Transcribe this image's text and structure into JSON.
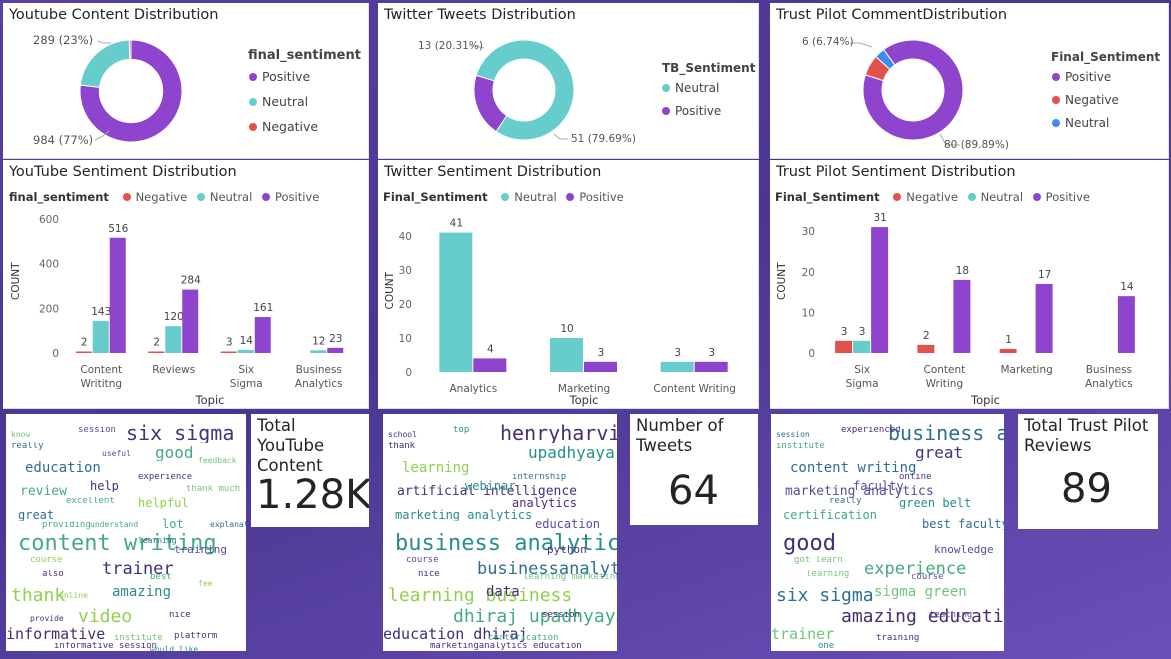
{
  "colors": {
    "positive": "#8e44cc",
    "neutral": "#66cccc",
    "negative": "#e0534d",
    "trust_neutral": "#3b8ef0"
  },
  "donuts": {
    "youtube": {
      "title": "Youtube Content Distribution",
      "legend_title": "final_sentiment",
      "legend": [
        "Positive",
        "Neutral",
        "Negative"
      ],
      "label_top": "289 (23%)",
      "label_bottom": "984 (77%)"
    },
    "twitter": {
      "title": "Twitter Tweets Distribution",
      "legend_title": "TB_Sentiment",
      "legend": [
        "Neutral",
        "Positive"
      ],
      "label_top": "13 (20.31%)",
      "label_bottom": "51 (79.69%)"
    },
    "trust": {
      "title": "Trust Pilot CommentDistribution",
      "legend_title": "Final_Sentiment",
      "legend": [
        "Positive",
        "Negative",
        "Neutral"
      ],
      "label_top": "6 (6.74%)",
      "label_bottom": "80 (89.89%)"
    }
  },
  "bars": {
    "youtube": {
      "title": "YouTube Sentiment Distribution",
      "legend_title": "final_sentiment",
      "legend": [
        "Negative",
        "Neutral",
        "Positive"
      ],
      "ylabel": "COUNT",
      "xlabel": "Topic"
    },
    "twitter": {
      "title": "Twitter Sentiment Distribution",
      "legend_title": "Final_Sentiment",
      "legend": [
        "Neutral",
        "Positive"
      ],
      "ylabel": "COUNT",
      "xlabel": "Topic"
    },
    "trust": {
      "title": "Trust Pilot Sentiment Distribution",
      "legend_title": "Final_Sentiment",
      "legend": [
        "Negative",
        "Neutral",
        "Positive"
      ],
      "ylabel": "COUNT",
      "xlabel": "Topic"
    }
  },
  "cards": {
    "youtube": {
      "label": "Total YouTube Content",
      "value": "1.28K"
    },
    "twitter": {
      "label": "Number of Tweets",
      "value": "64"
    },
    "trust": {
      "label": "Total Trust Pilot Reviews",
      "value": "89"
    }
  },
  "wordclouds": {
    "youtube": [
      "content writing",
      "thank",
      "six sigma",
      "education",
      "review",
      "helpful",
      "trainer",
      "informative",
      "video",
      "good",
      "great",
      "amazing",
      "training",
      "help",
      "lot",
      "really",
      "session",
      "experience",
      "course",
      "best",
      "also",
      "nice",
      "know",
      "institute",
      "informative session",
      "excellent",
      "thank much",
      "platform",
      "providing",
      "fee",
      "useful",
      "learning",
      "provide",
      "feedback",
      "understand",
      "explanation",
      "online",
      "would like"
    ],
    "twitter": [
      "business analytics",
      "learning business",
      "henryharvin",
      "learning",
      "artificial intelligence",
      "analytics",
      "businessanalytics",
      "education dhiraj",
      "dhiraj upadhyaya",
      "upadhyaya sep",
      "marketing analytics",
      "data",
      "python",
      "webinar",
      "education",
      "thank",
      "top",
      "internship",
      "course",
      "learning marketing",
      "nice",
      "session",
      "school",
      "certification",
      "marketinganalytics education"
    ],
    "trust": [
      "good",
      "six sigma",
      "business analytics",
      "content writing",
      "marketing analytics",
      "green belt",
      "experience",
      "trainer",
      "amazing education",
      "great",
      "certification",
      "sigma green",
      "knowledge",
      "faculty",
      "best faculty",
      "institute",
      "experienced",
      "online",
      "got learn",
      "course",
      "learning",
      "teaching",
      "session",
      "training",
      "one",
      "really"
    ]
  },
  "chart_data": [
    {
      "type": "pie",
      "title": "Youtube Content Distribution",
      "legend_title": "final_sentiment",
      "categories": [
        "Positive",
        "Neutral",
        "Negative"
      ],
      "values": [
        984,
        289,
        7
      ],
      "labels": [
        "984 (77%)",
        "289 (23%)",
        ""
      ]
    },
    {
      "type": "pie",
      "title": "Twitter Tweets Distribution",
      "legend_title": "TB_Sentiment",
      "categories": [
        "Neutral",
        "Positive"
      ],
      "values": [
        51,
        13
      ],
      "labels": [
        "51 (79.69%)",
        "13 (20.31%)"
      ]
    },
    {
      "type": "pie",
      "title": "Trust Pilot CommentDistribution",
      "legend_title": "Final_Sentiment",
      "categories": [
        "Positive",
        "Negative",
        "Neutral"
      ],
      "values": [
        80,
        6,
        3
      ],
      "labels": [
        "80 (89.89%)",
        "6 (6.74%)",
        ""
      ]
    },
    {
      "type": "bar",
      "title": "YouTube Sentiment Distribution",
      "categories": [
        "Content Writitng",
        "Reviews",
        "Six Sigma",
        "Business Analytics"
      ],
      "series": [
        {
          "name": "Negative",
          "values": [
            2,
            2,
            3,
            null
          ]
        },
        {
          "name": "Neutral",
          "values": [
            143,
            120,
            14,
            12
          ]
        },
        {
          "name": "Positive",
          "values": [
            516,
            284,
            161,
            23
          ]
        }
      ],
      "xlabel": "Topic",
      "ylabel": "COUNT",
      "ylim": [
        0,
        600
      ],
      "yticks": [
        0,
        200,
        400,
        600
      ]
    },
    {
      "type": "bar",
      "title": "Twitter Sentiment Distribution",
      "categories": [
        "Analytics",
        "Marketing",
        "Content Writing"
      ],
      "series": [
        {
          "name": "Neutral",
          "values": [
            41,
            10,
            3
          ]
        },
        {
          "name": "Positive",
          "values": [
            4,
            3,
            3
          ]
        }
      ],
      "xlabel": "Topic",
      "ylabel": "COUNT",
      "ylim": [
        0,
        45
      ],
      "yticks": [
        0,
        10,
        20,
        30,
        40
      ]
    },
    {
      "type": "bar",
      "title": "Trust Pilot Sentiment Distribution",
      "categories": [
        "Six Sigma",
        "Content Writing",
        "Marketing",
        "Business Analytics"
      ],
      "series": [
        {
          "name": "Negative",
          "values": [
            3,
            2,
            1,
            null
          ]
        },
        {
          "name": "Neutral",
          "values": [
            3,
            null,
            null,
            null
          ]
        },
        {
          "name": "Positive",
          "values": [
            31,
            18,
            17,
            14
          ]
        }
      ],
      "xlabel": "Topic",
      "ylabel": "COUNT",
      "ylim": [
        0,
        33
      ],
      "yticks": [
        0,
        10,
        20,
        30
      ]
    }
  ]
}
